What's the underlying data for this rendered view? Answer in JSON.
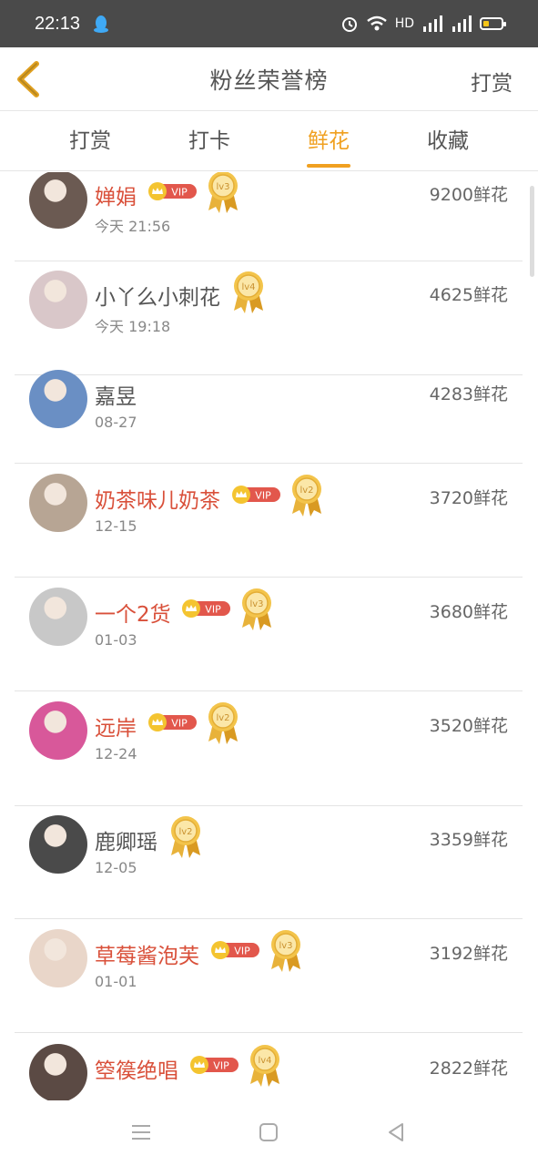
{
  "status": {
    "time": "22:13",
    "network_label": "HD"
  },
  "header": {
    "title": "粉丝荣誉榜",
    "action": "打赏"
  },
  "tabs": [
    {
      "label": "打赏",
      "active": false
    },
    {
      "label": "打卡",
      "active": false
    },
    {
      "label": "鲜花",
      "active": true
    },
    {
      "label": "收藏",
      "active": false
    }
  ],
  "vip_text": "VIP",
  "entries": [
    {
      "name": "婵娟",
      "vip": true,
      "level": "lv3",
      "time": "今天 21:56",
      "amount": "9200鲜花",
      "avatar": "#6b5a52"
    },
    {
      "name": "小丫么小刺花",
      "vip": false,
      "level": "lv4",
      "time": "今天 19:18",
      "amount": "4625鲜花",
      "avatar": "#d9c7c9"
    },
    {
      "name": "嘉昱",
      "vip": false,
      "level": "",
      "time": "08-27",
      "amount": "4283鲜花",
      "avatar": "#6a8fc4"
    },
    {
      "name": "奶茶味儿奶茶",
      "vip": true,
      "level": "lv2",
      "time": "12-15",
      "amount": "3720鲜花",
      "avatar": "#b7a594"
    },
    {
      "name": "一个2货",
      "vip": true,
      "level": "lv3",
      "time": "01-03",
      "amount": "3680鲜花",
      "avatar": "#c8c8c8"
    },
    {
      "name": "远岸",
      "vip": true,
      "level": "lv2",
      "time": "12-24",
      "amount": "3520鲜花",
      "avatar": "#d8589a"
    },
    {
      "name": "鹿卿瑶",
      "vip": false,
      "level": "lv2",
      "time": "12-05",
      "amount": "3359鲜花",
      "avatar": "#4a4a4a"
    },
    {
      "name": "草莓酱泡芙",
      "vip": true,
      "level": "lv3",
      "time": "01-01",
      "amount": "3192鲜花",
      "avatar": "#e9d6c9"
    },
    {
      "name": "箜篌绝唱",
      "vip": true,
      "level": "lv4",
      "time": "",
      "amount": "2822鲜花",
      "avatar": "#5b4a44"
    }
  ],
  "colors": {
    "accent": "#f0a020",
    "vip_name": "#d9503a",
    "status_bar": "#4a4a4a"
  }
}
